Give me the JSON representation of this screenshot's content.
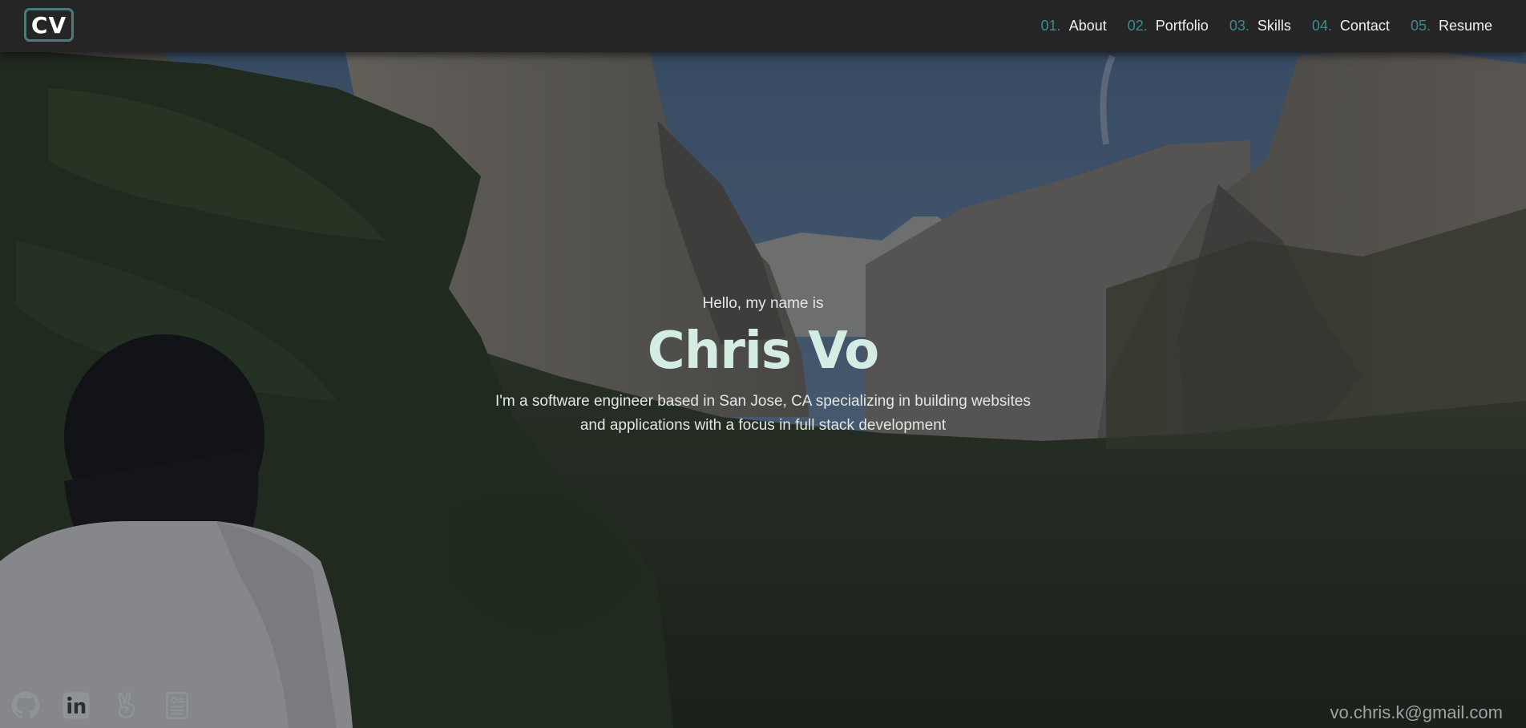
{
  "logo": {
    "text": "CV"
  },
  "nav": {
    "items": [
      {
        "num": "01.",
        "label": "About"
      },
      {
        "num": "02.",
        "label": "Portfolio"
      },
      {
        "num": "03.",
        "label": "Skills"
      },
      {
        "num": "04.",
        "label": "Contact"
      },
      {
        "num": "05.",
        "label": "Resume"
      }
    ]
  },
  "hero": {
    "greeting": "Hello, my name is",
    "name": "Chris Vo",
    "tagline_line1": "I'm a software engineer based in San Jose, CA specializing in building websites",
    "tagline_line2": "and applications with a focus in full stack development"
  },
  "socials": {
    "icons": [
      "github-icon",
      "linkedin-icon",
      "angellist-icon",
      "resume-icon"
    ]
  },
  "contact": {
    "email": "vo.chris.k@gmail.com"
  },
  "colors": {
    "navbar_bg": "#252525",
    "accent": "#3f8a8a",
    "logo_border": "#4b7c7a",
    "name": "#d3ede4"
  }
}
